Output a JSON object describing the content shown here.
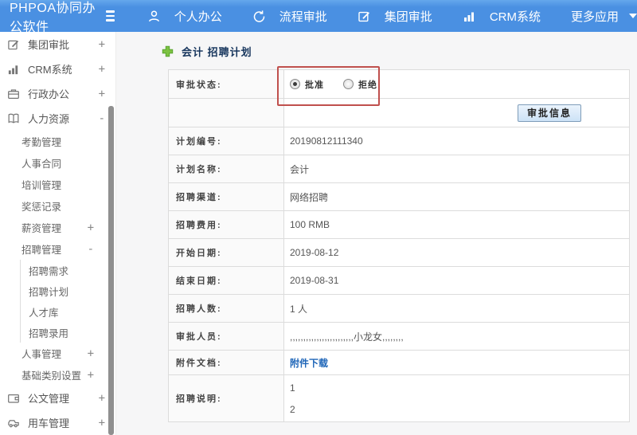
{
  "colors": {
    "header_blue": "#4a90e2",
    "title_navy": "#17365d",
    "link_blue": "#1f66b8",
    "plus_green": "#7dc242",
    "annotation_red": "#c0504d"
  },
  "header": {
    "logo": "PHPOA协同办公软件",
    "nav": [
      {
        "label": "个人办公",
        "icon": "user-icon"
      },
      {
        "label": "流程审批",
        "icon": "process-icon"
      },
      {
        "label": "集团审批",
        "icon": "edit-square-icon"
      },
      {
        "label": "CRM系统",
        "icon": "bar-chart-icon"
      },
      {
        "label": "更多应用",
        "icon": "caret-down-icon"
      }
    ]
  },
  "sidebar": {
    "groups": [
      {
        "label": "集团审批",
        "toggle": "+",
        "icon": "edit-square-icon"
      },
      {
        "label": "CRM系统",
        "toggle": "+",
        "icon": "bar-chart-icon"
      },
      {
        "label": "行政办公",
        "toggle": "+",
        "icon": "briefcase-icon"
      },
      {
        "label": "人力资源",
        "toggle": "-",
        "icon": "book-icon",
        "children": [
          {
            "label": "考勤管理"
          },
          {
            "label": "人事合同"
          },
          {
            "label": "培训管理"
          },
          {
            "label": "奖惩记录"
          },
          {
            "label": "薪资管理",
            "toggle": "+"
          },
          {
            "label": "招聘管理",
            "toggle": "-",
            "children": [
              {
                "label": "招聘需求"
              },
              {
                "label": "招聘计划"
              },
              {
                "label": "人才库"
              },
              {
                "label": "招聘录用"
              }
            ]
          },
          {
            "label": "人事管理",
            "toggle": "+"
          },
          {
            "label": "基础类别设置",
            "toggle": "+"
          }
        ]
      },
      {
        "label": "公文管理",
        "toggle": "+",
        "icon": "wallet-icon"
      },
      {
        "label": "用车管理",
        "toggle": "+",
        "icon": "car-icon"
      }
    ]
  },
  "main": {
    "title": "会计 招聘计划",
    "approval": {
      "label": "审批状态:",
      "options": [
        {
          "label": "批准",
          "checked": true
        },
        {
          "label": "拒绝",
          "checked": false
        }
      ]
    },
    "button_label": "审批信息",
    "fields": [
      {
        "label": "计划编号:",
        "value": "20190812111340"
      },
      {
        "label": "计划名称:",
        "value": "会计"
      },
      {
        "label": "招聘渠道:",
        "value": "网络招聘"
      },
      {
        "label": "招聘费用:",
        "value": "100 RMB"
      },
      {
        "label": "开始日期:",
        "value": "2019-08-12"
      },
      {
        "label": "结束日期:",
        "value": "2019-08-31"
      },
      {
        "label": "招聘人数:",
        "value": "1 人"
      },
      {
        "label": "审批人员:",
        "value": ",,,,,,,,,,,,,,,,,,,,,,,,小龙女,,,,,,,,"
      },
      {
        "label": "附件文档:",
        "value": "附件下载"
      },
      {
        "label": "招聘说明:",
        "lines": [
          "1",
          "2"
        ]
      }
    ]
  }
}
